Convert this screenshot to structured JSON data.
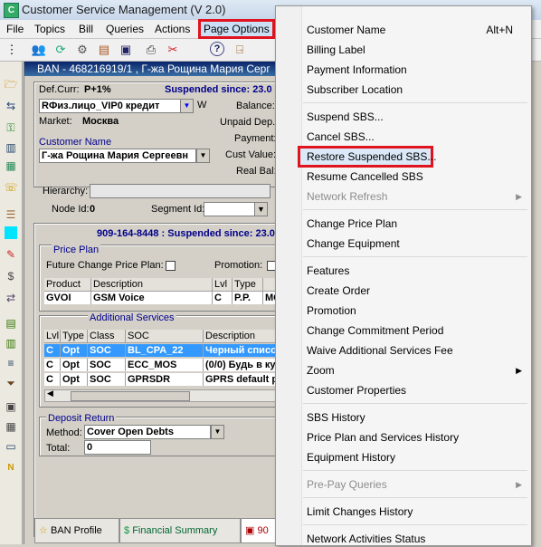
{
  "app": {
    "title": "Customer Service Management  (V 2.0)",
    "icon_letter": "C"
  },
  "menubar": [
    "File",
    "Topics",
    "Bill",
    "Queries",
    "Actions",
    "Page Options"
  ],
  "inner_window": {
    "title": "BAN - 468216919/1 , Г-жа Рощина Мария Серг",
    "def_curr_label": "Def.Curr:",
    "def_curr_value": "P+1%",
    "suspended": "Suspended since: 23.0",
    "account_type": "RФиз.лицо_VIP0 кредит",
    "w_label": "W",
    "market_label": "Market:",
    "market_value": "Москва",
    "customer_name_label": "Customer Name",
    "customer_name_value": "Г-жа Рощина Мария Сергеевн",
    "balance_label": "Balance:",
    "unpaid_label": "Unpaid Dep.:",
    "payment_label": "Payment:",
    "cust_value_label": "Cust Value:",
    "real_bal_label": "Real Bal:",
    "hierarchy_label": "Hierarchy:",
    "node_id_label": "Node Id:",
    "node_id_value": "0",
    "segment_id_label": "Segment Id:",
    "subscriber": "909-164-8448 : Suspended since: 23.0",
    "price_plan_title": "Price Plan",
    "future_change_label": "Future Change Price Plan:",
    "promotion_label": "Promotion:",
    "pp_headers": [
      "Product",
      "Description",
      "Lvl",
      "Type",
      ""
    ],
    "pp_row": [
      "GVOI",
      "GSM Voice",
      "C",
      "P.P.",
      "MC"
    ],
    "add_services_title": "Additional Services",
    "as_headers": [
      "Lvl",
      "Type",
      "Class",
      "SOC",
      "Description"
    ],
    "as_rows": [
      [
        "C",
        "Opt",
        "SOC",
        "BL_CPA_22",
        "Черный списо"
      ],
      [
        "C",
        "Opt",
        "SOC",
        "ECC_MOS",
        "(0/0) Будь в ку"
      ],
      [
        "C",
        "Opt",
        "SOC",
        "GPRSDR",
        "GPRS default p"
      ]
    ],
    "deposit_title": "Deposit Return",
    "method_label": "Method:",
    "method_value": "Cover Open Debts",
    "total_label": "Total:",
    "total_value": "0"
  },
  "bottom_tabs": [
    "BAN Profile",
    "Financial Summary",
    "90"
  ],
  "dropdown": {
    "items": [
      {
        "label": "Customer Name",
        "shortcut": "Alt+N"
      },
      {
        "label": "Billing Label"
      },
      {
        "label": "Payment Information"
      },
      {
        "label": "Subscriber Location"
      },
      {
        "label": "Suspend SBS..."
      },
      {
        "label": "Cancel SBS..."
      },
      {
        "label": "Restore Suspended SBS..."
      },
      {
        "label": "Resume Cancelled SBS"
      },
      {
        "label": "Network Refresh"
      },
      {
        "label": "Change Price Plan"
      },
      {
        "label": "Change Equipment"
      },
      {
        "label": "Features"
      },
      {
        "label": "Create Order"
      },
      {
        "label": "Promotion"
      },
      {
        "label": "Change Commitment Period"
      },
      {
        "label": "Waive Additional Services Fee"
      },
      {
        "label": "Zoom"
      },
      {
        "label": "Customer Properties"
      },
      {
        "label": "SBS History"
      },
      {
        "label": "Price Plan and Services History"
      },
      {
        "label": "Equipment History"
      },
      {
        "label": "Pre-Pay Queries"
      },
      {
        "label": "Limit Changes History"
      },
      {
        "label": "Network Activities Status"
      }
    ]
  },
  "colors": {
    "highlight": "#e0141e",
    "selection": "#3399ff",
    "label_blue": "#00008b"
  }
}
